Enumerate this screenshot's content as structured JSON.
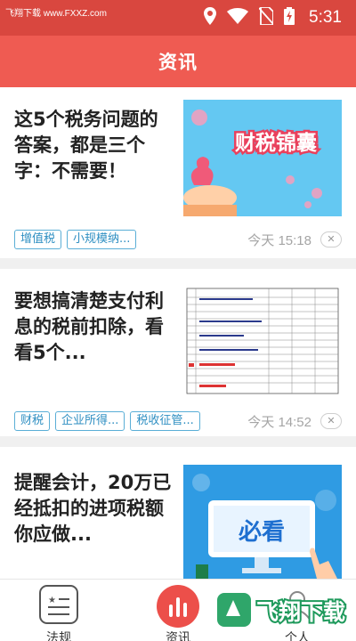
{
  "status_bar": {
    "watermark": "飞翔下载 www.FXXZ.com",
    "time": "5:31",
    "icons": [
      "location-icon",
      "wifi-icon",
      "no-sim-icon",
      "battery-charging-icon"
    ]
  },
  "header": {
    "title": "资讯"
  },
  "feed": {
    "articles": [
      {
        "title": "这5个税务问题的答案，都是三个字：不需要！",
        "thumbnail_text": "财税锦囊",
        "tags": [
          "增值税",
          "小规模纳..."
        ],
        "time": "今天 15:18"
      },
      {
        "title": "要想搞清楚支付利息的税前扣除，看看5个...",
        "tags": [
          "财税",
          "企业所得...",
          "税收征管..."
        ],
        "time": "今天 14:52"
      },
      {
        "title": "提醒会计，20万已经抵扣的进项税额你应做...",
        "thumbnail_text": "必看",
        "tags": [],
        "time": ""
      }
    ]
  },
  "bottom_nav": {
    "items": [
      {
        "label": "法规",
        "icon": "regulation-icon"
      },
      {
        "label": "资讯",
        "icon": "news-chart-icon",
        "active": true
      },
      {
        "label": "个人",
        "icon": "person-icon"
      }
    ]
  },
  "watermark": {
    "text": "飞翔下载"
  },
  "colors": {
    "status_bar": "#d9473f",
    "title_bar": "#ef5b52",
    "tag_border": "#5aaed6",
    "active_nav": "#ec4f4a"
  }
}
